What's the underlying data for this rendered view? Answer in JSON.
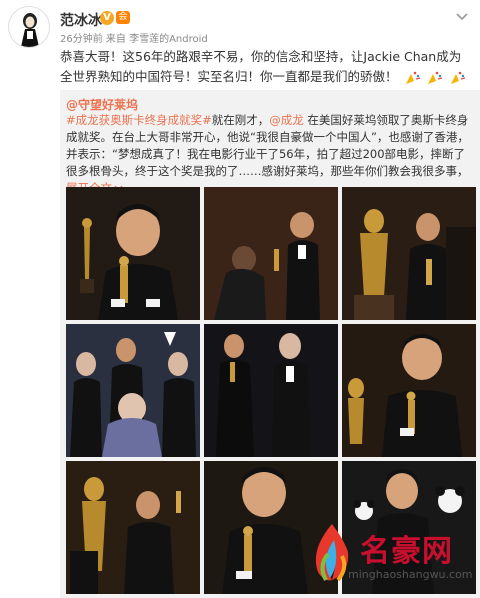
{
  "post": {
    "username": "范冰冰",
    "verified_badge": "V",
    "vip_badge": "会",
    "meta": "26分钟前 来自 李雪莲的Android",
    "text": "恭喜大哥！这56年的路艰辛不易，你的信念和坚持，让Jackie Chan成为全世界熟知的中国符号！实至名归！你一直都是我们的骄傲！",
    "emoji_count": 3
  },
  "repost": {
    "user": "@守望好莱坞",
    "hashtag": "#成龙获奥斯卡终身成就奖#",
    "text_a": "就在刚才，",
    "mention": "@成龙",
    "text_b": " 在美国好莱坞领取了奥斯卡终身成就奖。在台上大哥非常开心，他说“我很自豪做一个中国人”，也感谢了香港，并表示：“梦想成真了！我在电影行业干了56年，拍了超过200部电影，摔断了很多根骨头，终于这个奖是我的了……感谢好莱坞，那些年你们教会我很多事，",
    "expand": "展开全文",
    "expand_icon": "chevron-down"
  },
  "watermark": {
    "name": "名豪网",
    "url": "minghaoshangwu.com"
  },
  "colors": {
    "link": "#eb7350",
    "repost_bg": "#f2f2f2",
    "photo_bg": "#1b1b1b",
    "gold": "#c8a24a"
  }
}
